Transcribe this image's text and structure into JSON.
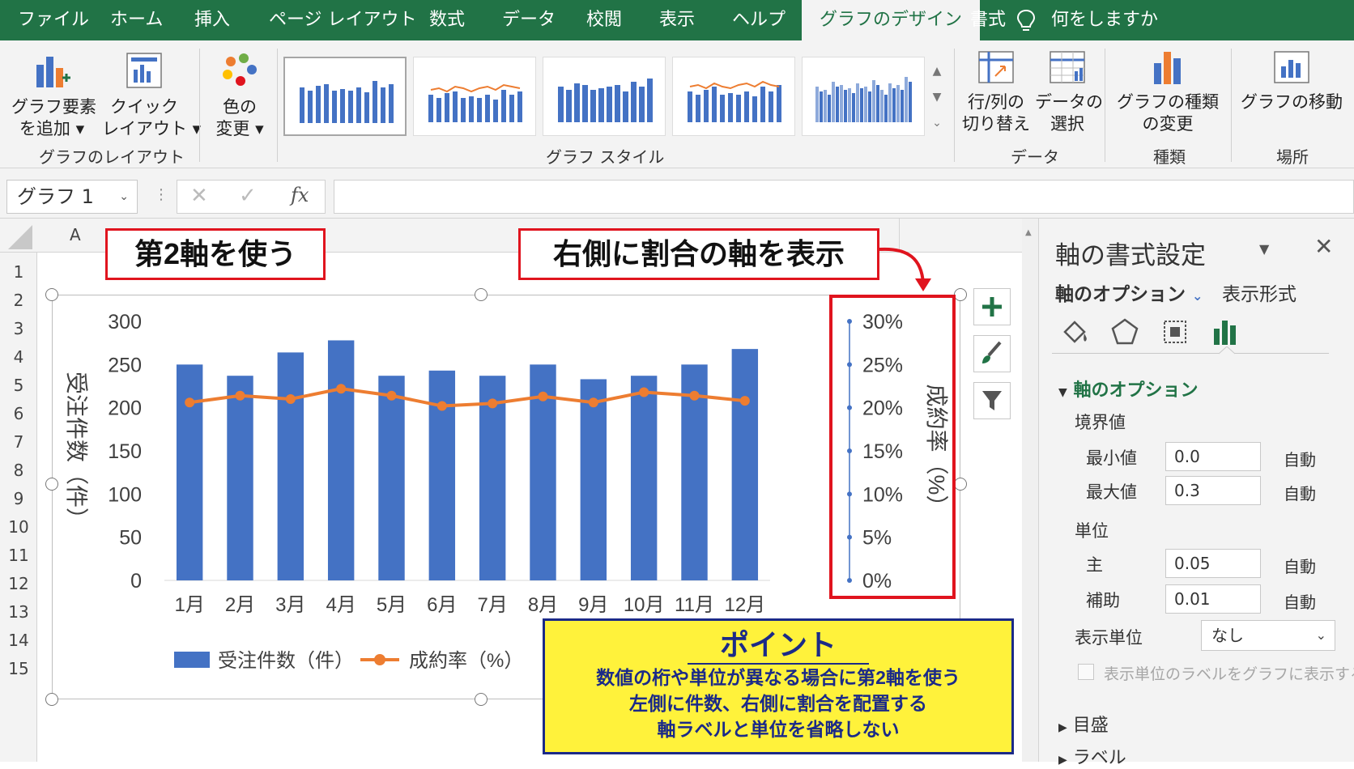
{
  "ribbon": {
    "tabs": [
      "ファイル",
      "ホーム",
      "挿入",
      "ページ レイアウト",
      "数式",
      "データ",
      "校閲",
      "表示",
      "ヘルプ",
      "グラフのデザイン",
      "書式"
    ],
    "active_tab": "グラフのデザイン",
    "tell_me": "何をしますか",
    "buttons": {
      "add_element": [
        "グラフ要素",
        "を追加"
      ],
      "quick_layout": [
        "クイック",
        "レイアウト"
      ],
      "change_colors": [
        "色の",
        "変更"
      ],
      "switch_row_col": [
        "行/列の",
        "切り替え"
      ],
      "select_data": [
        "データの",
        "選択"
      ],
      "change_type": [
        "グラフの種類",
        "の変更"
      ],
      "move_chart": "グラフの移動"
    },
    "groups": {
      "layouts": "グラフのレイアウト",
      "styles": "グラフ スタイル",
      "data": "データ",
      "type": "種類",
      "location": "場所"
    }
  },
  "formula_bar": {
    "name_box": "グラフ 1",
    "fx": "fx",
    "formula": ""
  },
  "sheet": {
    "column_header": "A",
    "rows": [
      "1",
      "2",
      "3",
      "4",
      "5",
      "6",
      "7",
      "8",
      "9",
      "10",
      "11",
      "12",
      "13",
      "14",
      "15"
    ]
  },
  "callouts": {
    "secondary_axis": "第2軸を使う",
    "right_axis": "右側に割合の軸を表示"
  },
  "point_box": {
    "title": "ポイント",
    "lines": [
      "数値の桁や単位が異なる場合に第2軸を使う",
      "左側に件数、右側に割合を配置する",
      "軸ラベルと単位を省略しない"
    ]
  },
  "chart_data": {
    "type": "bar",
    "categories": [
      "1月",
      "2月",
      "3月",
      "4月",
      "5月",
      "6月",
      "7月",
      "8月",
      "9月",
      "10月",
      "11月",
      "12月"
    ],
    "series": [
      {
        "name": "受注件数（件）",
        "type": "bar",
        "axis": "primary",
        "color": "#4472c4",
        "values": [
          250,
          237,
          264,
          278,
          237,
          243,
          237,
          250,
          233,
          237,
          250,
          268
        ]
      },
      {
        "name": "成約率（%）",
        "type": "line",
        "axis": "secondary",
        "color": "#ed7d31",
        "values": [
          0.206,
          0.214,
          0.21,
          0.222,
          0.214,
          0.202,
          0.205,
          0.213,
          0.206,
          0.218,
          0.214,
          0.208
        ]
      }
    ],
    "ylabel": "受注件数（件）",
    "y2label": "成約率（%）",
    "ylim": [
      0,
      300
    ],
    "yticks": [
      "0",
      "50",
      "100",
      "150",
      "200",
      "250",
      "300"
    ],
    "y2lim": [
      0,
      0.3
    ],
    "y2ticks": [
      "0%",
      "5%",
      "10%",
      "15%",
      "20%",
      "25%",
      "30%"
    ],
    "legend_position": "bottom",
    "grid": false
  },
  "pane": {
    "title": "軸の書式設定",
    "tab_options": "軸のオプション",
    "tab_format": "表示形式",
    "section": "軸のオプション",
    "bounds": "境界値",
    "min_label": "最小値",
    "min_value": "0.0",
    "max_label": "最大値",
    "max_value": "0.3",
    "units": "単位",
    "major_label": "主",
    "major_value": "0.05",
    "minor_label": "補助",
    "minor_value": "0.01",
    "auto": "自動",
    "display_units_label": "表示単位",
    "display_units_value": "なし",
    "show_units_label": "表示単位のラベルをグラフに表示する",
    "tick_marks": "目盛",
    "labels": "ラベル"
  },
  "colors": {
    "excel_green": "#217346",
    "bar_blue": "#4472c4",
    "line_orange": "#ed7d31",
    "callout_red": "#e0141e",
    "point_yellow": "#fff23b",
    "point_navy": "#1b2a88"
  }
}
